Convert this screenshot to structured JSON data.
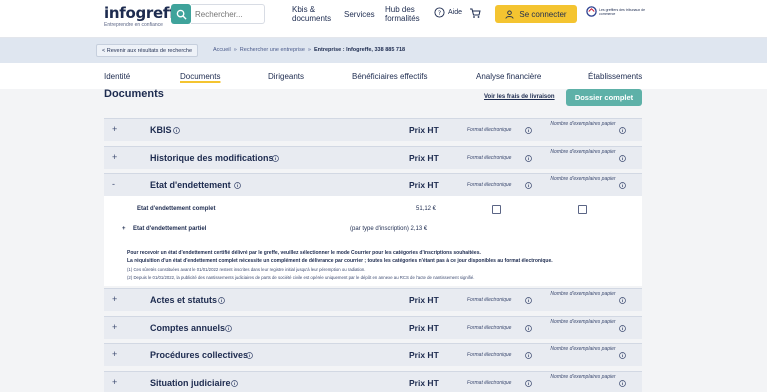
{
  "header": {
    "logo": "infogreffe",
    "logo_tagline": "Entreprendre en confiance",
    "search_placeholder": "Rechercher...",
    "nav": {
      "kbis_line1": "Kbis &",
      "kbis_line2": "documents",
      "services": "Services",
      "hub_line1": "Hub des",
      "hub_line2": "formalités",
      "help": "Aide"
    },
    "connect_label": "Se connecter",
    "ministry_text": "Les greffiers des tribunaux de commerce"
  },
  "breadcrumb": {
    "back": "< Revenir aux résultats de recherche",
    "items": [
      "Accueil",
      "»",
      "Rechercher une entreprise",
      "»",
      "Entreprise : Infogreffe, 338 885 718"
    ]
  },
  "tabs": [
    "Identité",
    "Documents",
    "Dirigeants",
    "Bénéficiaires effectifs",
    "Analyse financière",
    "Établissements"
  ],
  "page": {
    "title": "Documents",
    "fees_link": "Voir les frais de livraison",
    "dossier_button": "Dossier complet"
  },
  "columns": {
    "price": "Prix HT",
    "format": "Format électronique",
    "copies": "Nombre d'exemplaires papier"
  },
  "sections": [
    {
      "toggle": "+",
      "title": "KBIS"
    },
    {
      "toggle": "+",
      "title": "Historique des modifications"
    },
    {
      "toggle": "-",
      "title": "Etat d'endettement"
    },
    {
      "toggle": "+",
      "title": "Actes et statuts"
    },
    {
      "toggle": "+",
      "title": "Comptes annuels"
    },
    {
      "toggle": "+",
      "title": "Procédures collectives"
    },
    {
      "toggle": "+",
      "title": "Situation judiciaire"
    }
  ],
  "endettement": {
    "complete_label": "Etat d'endettement complet",
    "complete_price": "51,12 €",
    "partial_toggle": "+",
    "partial_label": "Etat d'endettement partiel",
    "partial_price": "(par type d'inscription) 2,13 €",
    "note1": "Pour recevoir un état d'endettement certifié délivré par le greffe, veuillez sélectionner le mode Courrier pour les catégories d'inscriptions souhaitées.",
    "note2": "La réquisition d'un état d'endettement complet nécessite un complément de délivrance par courrier ; toutes les catégories n'étant pas à ce jour disponibles au format électronique.",
    "note3": "(1) Ces sûretés constituées avant le 01/01/2022 restent inscrites dans leur registre initial jusqu'à leur péremption ou radiation.",
    "note4": "(2) Depuis le 01/01/2022, la publicité des nantissements judiciaires de parts de société civile est opérée uniquement par le dépôt en annexe au RCS de l'acte de nantissement signifié."
  },
  "colors": {
    "accent_teal": "#5eb1a8",
    "accent_yellow": "#f4c430",
    "navy": "#1d2b4f"
  }
}
